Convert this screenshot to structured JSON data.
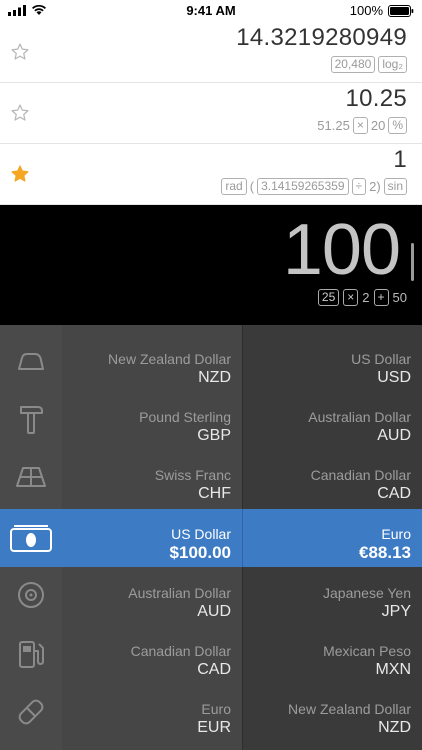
{
  "status": {
    "time": "9:41 AM",
    "battery": "100%"
  },
  "history": [
    {
      "starred": false,
      "result": "14.3219280949",
      "expr": [
        {
          "type": "box",
          "text": "20,480"
        },
        {
          "type": "box",
          "text": "log₂"
        }
      ]
    },
    {
      "starred": false,
      "result": "10.25",
      "expr": [
        {
          "type": "text",
          "text": "51.25"
        },
        {
          "type": "box",
          "text": "×"
        },
        {
          "type": "text",
          "text": "20"
        },
        {
          "type": "box",
          "text": "%"
        }
      ]
    },
    {
      "starred": true,
      "result": "1",
      "expr": [
        {
          "type": "box",
          "text": "rad"
        },
        {
          "type": "text",
          "text": "("
        },
        {
          "type": "box",
          "text": "3.14159265359"
        },
        {
          "type": "box",
          "text": "÷"
        },
        {
          "type": "text",
          "text": "2)"
        },
        {
          "type": "box",
          "text": "sin"
        }
      ]
    }
  ],
  "display": {
    "value": "100",
    "expr": [
      {
        "type": "box",
        "text": "25"
      },
      {
        "type": "box",
        "text": "×"
      },
      {
        "type": "text",
        "text": "2"
      },
      {
        "type": "box",
        "text": "+"
      },
      {
        "type": "text",
        "text": "50"
      }
    ]
  },
  "categories": [
    {
      "icon": "weight-icon"
    },
    {
      "icon": "hammer-icon"
    },
    {
      "icon": "area-icon"
    },
    {
      "icon": "currency-icon",
      "selected": true
    },
    {
      "icon": "disc-icon"
    },
    {
      "icon": "fuel-icon"
    },
    {
      "icon": "pill-icon"
    }
  ],
  "rows": [
    {
      "left": {
        "name": "New Zealand Dollar",
        "code": "NZD"
      },
      "right": {
        "name": "US Dollar",
        "code": "USD"
      }
    },
    {
      "left": {
        "name": "Pound Sterling",
        "code": "GBP"
      },
      "right": {
        "name": "Australian Dollar",
        "code": "AUD"
      }
    },
    {
      "left": {
        "name": "Swiss Franc",
        "code": "CHF"
      },
      "right": {
        "name": "Canadian Dollar",
        "code": "CAD"
      }
    },
    {
      "left": {
        "name": "US Dollar",
        "code": "$100.00"
      },
      "right": {
        "name": "Euro",
        "code": "€88.13"
      },
      "selected": true
    },
    {
      "left": {
        "name": "Australian Dollar",
        "code": "AUD"
      },
      "right": {
        "name": "Japanese Yen",
        "code": "JPY"
      }
    },
    {
      "left": {
        "name": "Canadian Dollar",
        "code": "CAD"
      },
      "right": {
        "name": "Mexican Peso",
        "code": "MXN"
      }
    },
    {
      "left": {
        "name": "Euro",
        "code": "EUR"
      },
      "right": {
        "name": "New Zealand Dollar",
        "code": "NZD"
      }
    }
  ],
  "colors": {
    "accent": "#3d7cc4",
    "star_active": "#f5a623"
  }
}
